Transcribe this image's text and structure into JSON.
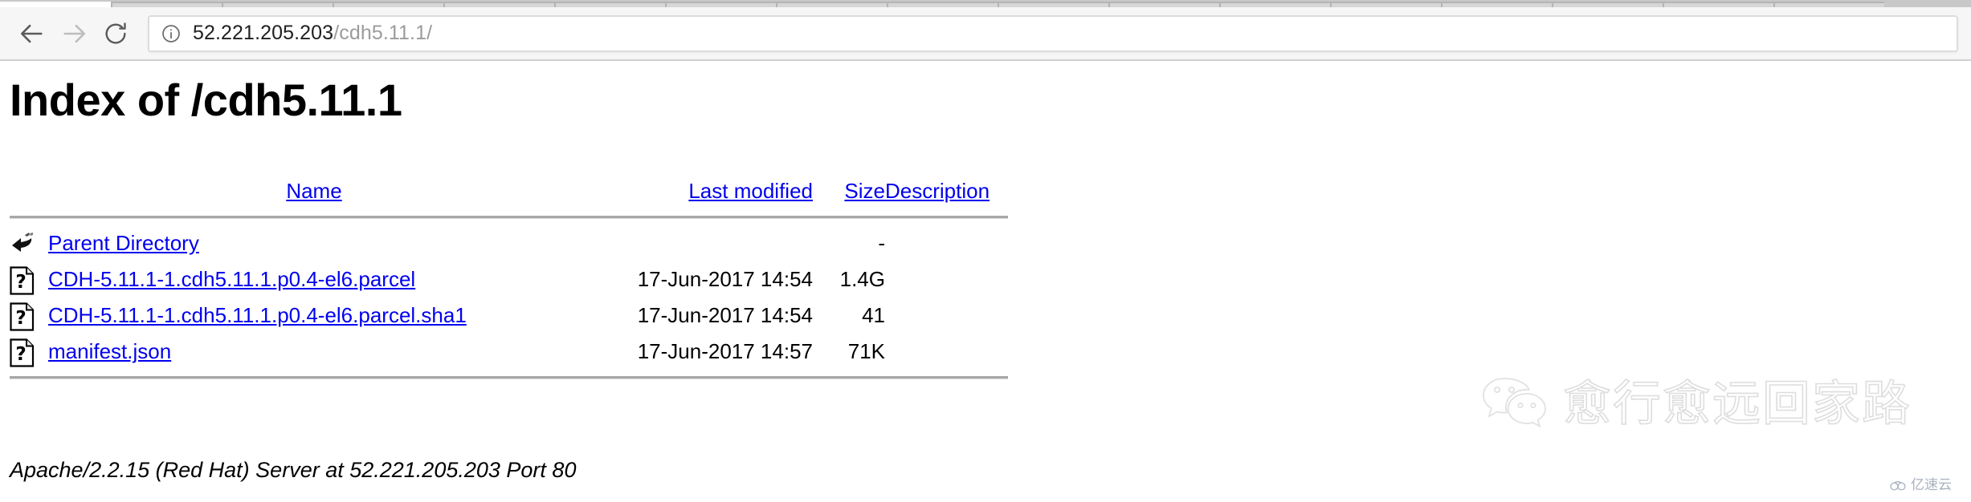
{
  "browser": {
    "back_label": "Back",
    "forward_label": "Forward",
    "reload_label": "Reload",
    "back_icon": "arrow-left-icon",
    "forward_icon": "arrow-right-icon",
    "reload_icon": "reload-icon",
    "security_icon": "info-circle-icon",
    "url_host": "52.221.205.203",
    "url_path": "/cdh5.11.1/",
    "url_full": "52.221.205.203/cdh5.11.1/",
    "tab_count": 17
  },
  "page": {
    "title": "Index of /cdh5.11.1",
    "footer": "Apache/2.2.15 (Red Hat) Server at 52.221.205.203 Port 80"
  },
  "listing": {
    "columns": [
      {
        "label": "Name",
        "key": "name"
      },
      {
        "label": "Last modified",
        "key": "date"
      },
      {
        "label": "Size",
        "key": "size"
      },
      {
        "label": "Description",
        "key": "desc"
      }
    ],
    "rows": [
      {
        "icon": "parent-directory-icon",
        "name": "Parent Directory",
        "date": "",
        "size": "-",
        "desc": ""
      },
      {
        "icon": "unknown-file-icon",
        "name": "CDH-5.11.1-1.cdh5.11.1.p0.4-el6.parcel",
        "date": "17-Jun-2017 14:54",
        "size": "1.4G",
        "desc": ""
      },
      {
        "icon": "unknown-file-icon",
        "name": "CDH-5.11.1-1.cdh5.11.1.p0.4-el6.parcel.sha1",
        "date": "17-Jun-2017 14:54",
        "size": "41",
        "desc": ""
      },
      {
        "icon": "unknown-file-icon",
        "name": "manifest.json",
        "date": "17-Jun-2017 14:57",
        "size": "71K",
        "desc": ""
      }
    ]
  },
  "watermark": {
    "logo_icon": "wechat-icon",
    "text": "愈行愈远回家路"
  },
  "corner_badge": {
    "logo_icon": "cloud-icon",
    "text": "亿速云"
  },
  "colors": {
    "link": "#0000ee",
    "chrome_bg": "#f6f6f6",
    "rule": "#a8a8a8",
    "url_host": "#1f1f1f",
    "url_path": "#9b9b9b"
  }
}
